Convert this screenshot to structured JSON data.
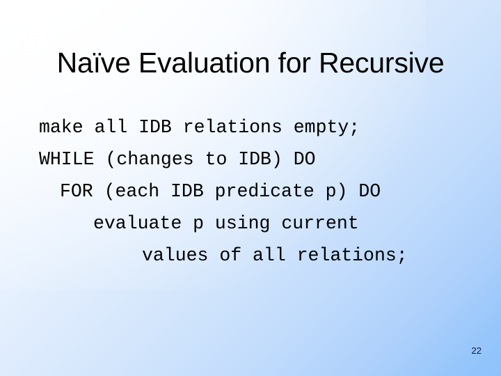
{
  "slide": {
    "title": "Naïve Evaluation for Recursive",
    "code_lines": [
      "make all IDB relations empty;",
      "WHILE (changes to IDB) DO",
      "FOR (each IDB predicate p) DO",
      "evaluate p using current",
      "values of all relations;"
    ],
    "page_number": "22",
    "colors": {
      "background_light": "#ffffff",
      "background_blue": "#8cc2fb",
      "title_text": "#000000",
      "code_text": "#000000",
      "page_number_text": "#1a1a3c"
    }
  }
}
